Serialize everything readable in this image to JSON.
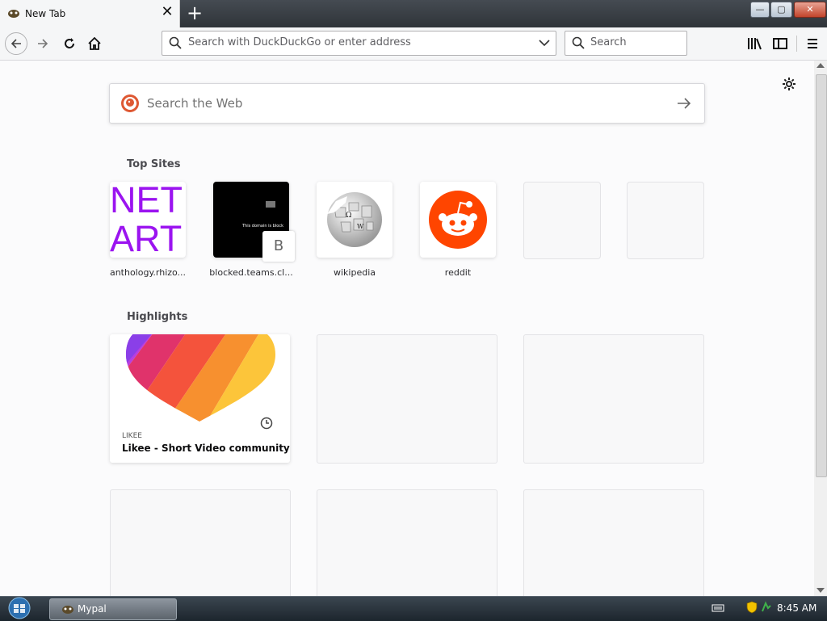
{
  "tab": {
    "title": "New Tab",
    "close": "✕"
  },
  "newtab": "+",
  "window_buttons": {
    "min": "—",
    "max": "▢",
    "close": "✕"
  },
  "urlbar": {
    "placeholder": "Search with DuckDuckGo or enter address"
  },
  "searchbar": {
    "placeholder": "Search"
  },
  "content": {
    "web_search_placeholder": "Search the Web",
    "top_sites_title": "Top Sites",
    "highlights_title": "Highlights",
    "top_sites": [
      {
        "label": "anthology.rhizo...",
        "tile_text_1": "NET",
        "tile_text_2": "ART"
      },
      {
        "label": "blocked.teams.cl...",
        "tile_text": "This domain is block",
        "badge": "B"
      },
      {
        "label": "wikipedia"
      },
      {
        "label": "reddit"
      }
    ],
    "highlight": {
      "source": "LIKEE",
      "title": "Likee - Short Video community"
    }
  },
  "taskbar": {
    "app": "Mypal",
    "time": "8:45 AM"
  },
  "colors": {
    "netart": "#9b14f0",
    "reddit": "#ff4500"
  }
}
